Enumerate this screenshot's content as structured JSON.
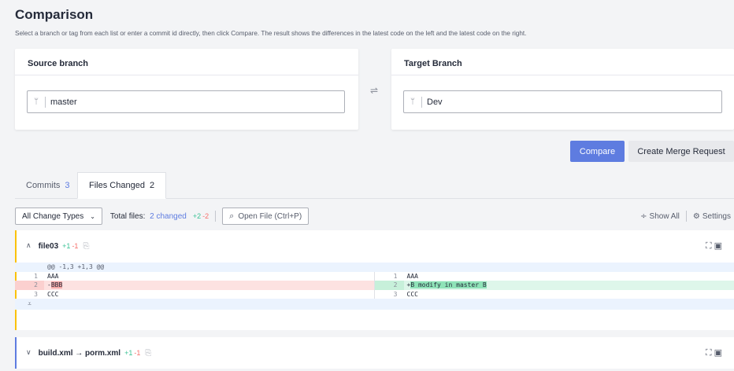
{
  "page": {
    "title": "Comparison",
    "subtitle": "Select a branch or tag from each list or enter a commit id directly, then click Compare. The result shows the differences in the latest code on the left and the latest code on the right."
  },
  "source": {
    "label": "Source branch",
    "value": "master",
    "icon": "branch-icon"
  },
  "target": {
    "label": "Target Branch",
    "value": "Dev",
    "icon": "branch-icon"
  },
  "swap_icon": "⇌",
  "actions": {
    "compare": "Compare",
    "merge_request": "Create Merge Request"
  },
  "colors": {
    "accent": "#5e7ce0",
    "added": "#3ac295",
    "removed": "#f66f6a"
  },
  "tabs": [
    {
      "label": "Commits",
      "count": "3",
      "active": false
    },
    {
      "label": "Files Changed",
      "count": "2",
      "active": true
    }
  ],
  "filters": {
    "change_types": "All Change Types",
    "total_prefix": "Total files:",
    "total_changed": "2 changed",
    "plus": "+2",
    "minus": "-2",
    "open_file": "Open File (Ctrl+P)",
    "show_all": "Show All",
    "settings": "Settings"
  },
  "files": [
    {
      "name": "file03",
      "plus": "+1",
      "minus": "-1",
      "expanded": true
    },
    {
      "name": "build.xml → porm.xml",
      "plus": "+1",
      "minus": "-1",
      "expanded": false
    }
  ],
  "diff": {
    "hunk": "@@ -1,3 +1,3 @@",
    "left": [
      {
        "num": "1",
        "text": "AAA",
        "type": "ctx"
      },
      {
        "num": "2",
        "prefix": "-",
        "text": "BBB",
        "type": "del"
      },
      {
        "num": "3",
        "text": "CCC",
        "type": "ctx"
      }
    ],
    "right": [
      {
        "num": "1",
        "text": "AAA",
        "type": "ctx"
      },
      {
        "num": "2",
        "prefix": "+",
        "text": "B modify in master B",
        "type": "add"
      },
      {
        "num": "3",
        "text": "CCC",
        "type": "ctx"
      }
    ]
  }
}
